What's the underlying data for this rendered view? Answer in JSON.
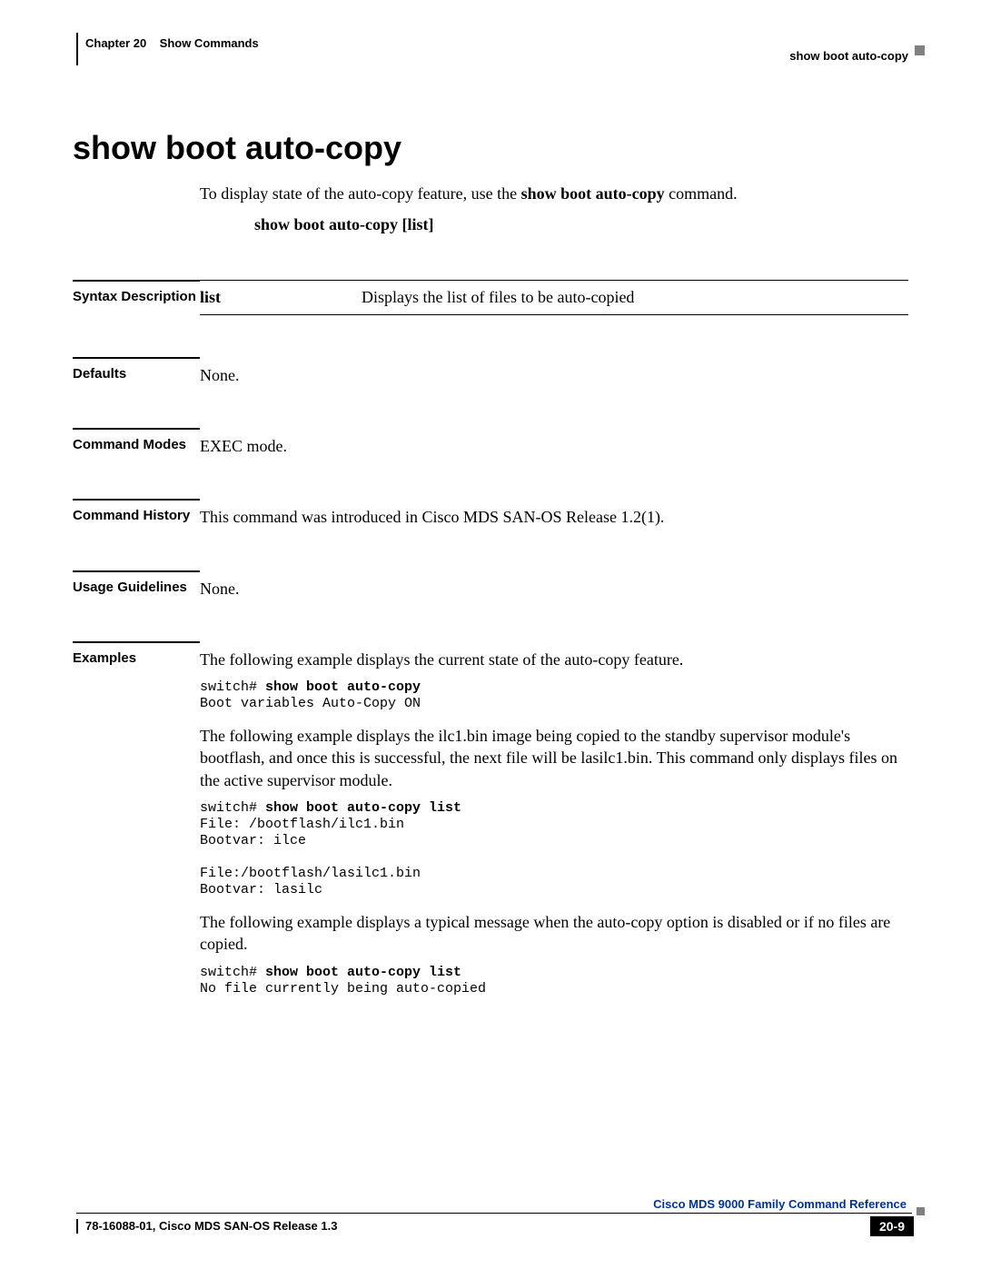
{
  "header": {
    "chapter_label": "Chapter 20",
    "chapter_title": "Show Commands",
    "right_label": "show boot auto-copy"
  },
  "title": "show boot auto-copy",
  "intro_pre": "To display state of the auto-copy feature, use the ",
  "intro_cmd": "show boot auto-copy",
  "intro_post": " command.",
  "syntax": "show boot auto-copy [list]",
  "sections": {
    "syntax_description": {
      "label": "Syntax Description",
      "term": "list",
      "desc": "Displays the list of files to be auto-copied"
    },
    "defaults": {
      "label": "Defaults",
      "text": "None."
    },
    "command_modes": {
      "label": "Command Modes",
      "text": "EXEC mode."
    },
    "command_history": {
      "label": "Command History",
      "text": "This command was introduced in Cisco MDS SAN-OS Release 1.2(1)."
    },
    "usage_guidelines": {
      "label": "Usage Guidelines",
      "text": "None."
    },
    "examples": {
      "label": "Examples",
      "para1": "The following example displays the current state of the auto-copy feature.",
      "code1_prompt": "switch# ",
      "code1_cmd": "show boot auto-copy",
      "code1_out": "Boot variables Auto-Copy ON",
      "para2": "The following example displays the ilc1.bin image being copied to the standby supervisor module's bootflash, and once this is successful, the next file will be lasilc1.bin. This command only displays files on the active supervisor module.",
      "code2_prompt": "switch# ",
      "code2_cmd": "show boot auto-copy list",
      "code2_out1": "File: /bootflash/ilc1.bin",
      "code2_out2": "Bootvar: ilce",
      "code2_out3": "File:/bootflash/lasilc1.bin",
      "code2_out4": "Bootvar: lasilc",
      "para3": "The following example displays a typical message when the auto-copy option is disabled or if no files are copied.",
      "code3_prompt": "switch# ",
      "code3_cmd": "show boot auto-copy list",
      "code3_out": "No file currently being auto-copied"
    }
  },
  "footer": {
    "title": "Cisco MDS 9000 Family Command Reference",
    "left": "78-16088-01, Cisco MDS SAN-OS Release 1.3",
    "page": "20-9"
  }
}
